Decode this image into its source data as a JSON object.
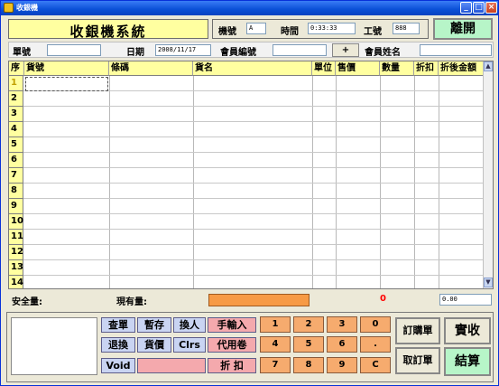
{
  "window": {
    "title": "收銀機"
  },
  "header": {
    "app_title": "收銀機系統",
    "machine_label": "機號",
    "machine_value": "A",
    "time_label": "時間",
    "time_value": "0:33:33",
    "staff_label": "工號",
    "staff_value": "888",
    "exit_label": "離開"
  },
  "info": {
    "order_label": "單號",
    "order_value": "",
    "date_label": "日期",
    "date_value": "2008/11/17",
    "member_no_label": "會員編號",
    "member_no_value": "",
    "plus_label": "+",
    "member_name_label": "會員姓名",
    "member_name_value": ""
  },
  "grid": {
    "columns": [
      "序",
      "貨號",
      "條碼",
      "貨名",
      "單位",
      "售價",
      "數量",
      "折扣",
      "折後金額"
    ],
    "rows": [
      "1",
      "2",
      "3",
      "4",
      "5",
      "6",
      "7",
      "8",
      "9",
      "10",
      "11",
      "12",
      "13",
      "14"
    ]
  },
  "status": {
    "safety_label": "安全量:",
    "stock_label": "現有量:",
    "total_value": "0",
    "amount_value": "0.00"
  },
  "functions": {
    "query": "查單",
    "hold": "暫存",
    "change_person": "換人",
    "manual": "手輸入",
    "return": "退換",
    "price": "貨價",
    "clrs": "Clrs",
    "voucher": "代用卷",
    "void": "Void",
    "discount": "折 扣"
  },
  "numpad": {
    "row1": [
      "1",
      "2",
      "3",
      "0"
    ],
    "row2": [
      "4",
      "5",
      "6",
      "."
    ],
    "row3": [
      "7",
      "8",
      "9",
      "C"
    ]
  },
  "actions": {
    "order": "訂購單",
    "cancel_order": "取訂單",
    "paid": "實收",
    "checkout": "結算"
  },
  "colors": {
    "title_bg": "#ffffa0",
    "exit_bg": "#b7f5c8",
    "num_key": "#f6ab6e",
    "func_key": "#c9d4f2",
    "pink_key": "#f4a9ad",
    "stock_bar": "#f79a45",
    "total_red": "#ff0000"
  }
}
